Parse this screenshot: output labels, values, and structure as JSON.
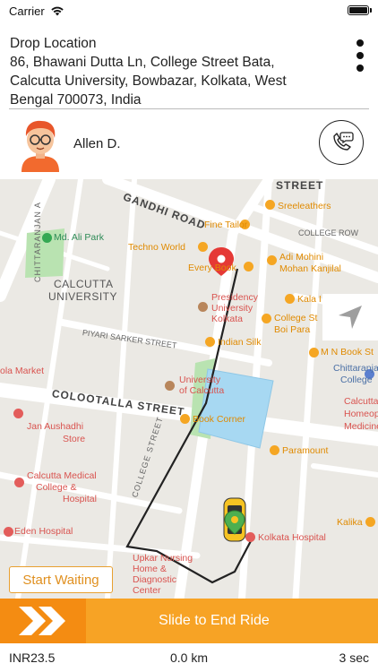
{
  "status_bar": {
    "carrier": "Carrier",
    "time": ""
  },
  "drop": {
    "title": "Drop Location",
    "address": "86, Bhawani Dutta Ln, College Street Bata, Calcutta University, Bowbazar, Kolkata, West Bengal 700073, India"
  },
  "rider": {
    "name": "Allen D."
  },
  "map": {
    "labels": [
      {
        "text": "GANDHI ROAD",
        "style": "street"
      },
      {
        "text": "STREET",
        "style": "street"
      },
      {
        "text": "Sreeleathers",
        "style": "poi"
      },
      {
        "text": "Fine Tailor",
        "style": "poi"
      },
      {
        "text": "COLLEGE ROW",
        "style": "gray"
      },
      {
        "text": "Md. Ali Park",
        "style": "green"
      },
      {
        "text": "Techno World",
        "style": "poi"
      },
      {
        "text": "Adi Mohini",
        "style": "poi"
      },
      {
        "text": "Mohan Kanjilal",
        "style": "poi"
      },
      {
        "text": "Every Book",
        "style": "poi"
      },
      {
        "text": "CALCUTTA",
        "style": "district"
      },
      {
        "text": "UNIVERSITY",
        "style": "district"
      },
      {
        "text": "Presidency",
        "style": "red"
      },
      {
        "text": "University",
        "style": "red"
      },
      {
        "text": "Kolkata",
        "style": "red"
      },
      {
        "text": "Kala I",
        "style": "poi"
      },
      {
        "text": "College St",
        "style": "poi"
      },
      {
        "text": "Boi Para",
        "style": "poi"
      },
      {
        "text": "PIYARI SARKER STREET",
        "style": "gray"
      },
      {
        "text": "Indian Silk",
        "style": "poi"
      },
      {
        "text": "M N Book St",
        "style": "poi"
      },
      {
        "text": "ola Market",
        "style": "red"
      },
      {
        "text": "Chittaranjan",
        "style": "blue"
      },
      {
        "text": "College",
        "style": "blue"
      },
      {
        "text": "University",
        "style": "red"
      },
      {
        "text": "of Calcutta",
        "style": "red"
      },
      {
        "text": "COLOOTALLA STREET",
        "style": "street"
      },
      {
        "text": "Jan Aushadhi",
        "style": "red"
      },
      {
        "text": "Store",
        "style": "red"
      },
      {
        "text": "Book Corner",
        "style": "poi"
      },
      {
        "text": "Calcutta",
        "style": "red"
      },
      {
        "text": "Homeopath",
        "style": "red"
      },
      {
        "text": "Medicine",
        "style": "red"
      },
      {
        "text": "Paramount",
        "style": "poi"
      },
      {
        "text": "Calcutta Medical",
        "style": "red"
      },
      {
        "text": "College &",
        "style": "red"
      },
      {
        "text": "Hospital",
        "style": "red"
      },
      {
        "text": "COLLEGE STREET",
        "style": "gray"
      },
      {
        "text": "Eden Hospital",
        "style": "red"
      },
      {
        "text": "Kalika",
        "style": "poi"
      },
      {
        "text": "Kolkata Hospital",
        "style": "red"
      },
      {
        "text": "Upkar Nursing",
        "style": "red"
      },
      {
        "text": "Home &",
        "style": "red"
      },
      {
        "text": "Diagnostic",
        "style": "red"
      },
      {
        "text": "Center",
        "style": "red"
      },
      {
        "text": "CHITTARANJAN A",
        "style": "gray"
      }
    ]
  },
  "actions": {
    "start_waiting": "Start Waiting",
    "slide_to_end": "Slide to End Ride"
  },
  "footer": {
    "fare": "INR23.5",
    "distance": "0.0 km",
    "duration": "3 sec"
  },
  "colors": {
    "accent": "#f7a325",
    "accent_dark": "#f48c12",
    "map_bg": "#ebe9e4",
    "route": "#222222",
    "pin": "#e53935"
  }
}
